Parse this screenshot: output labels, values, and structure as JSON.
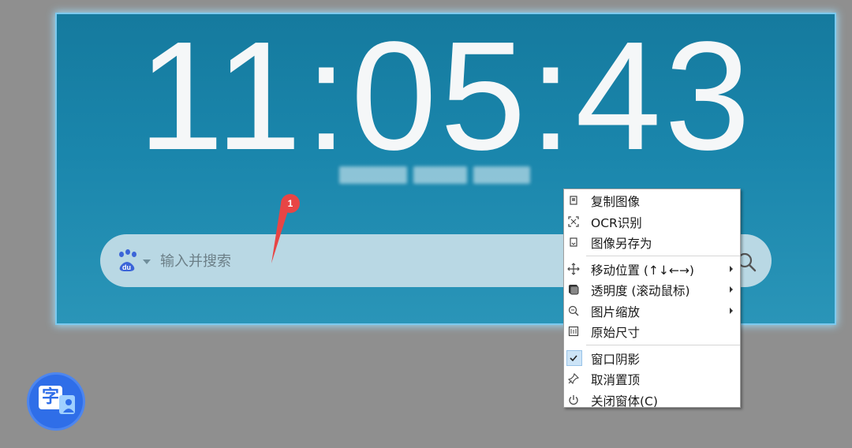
{
  "clock": {
    "time": "11:05:43"
  },
  "search": {
    "placeholder": "输入并搜索",
    "engine_icon": "baidu-paw-icon",
    "button_icon": "search-icon"
  },
  "annotation": {
    "marker_number": "1",
    "color": "#e84545"
  },
  "context_menu": {
    "items": [
      {
        "label": "复制图像",
        "icon": "copy-image-icon"
      },
      {
        "label": "OCR识别",
        "icon": "ocr-scan-icon"
      },
      {
        "label": "图像另存为",
        "icon": "save-image-icon"
      },
      {
        "label": "移动位置 (↑↓←→)",
        "icon": "move-icon",
        "submenu": true
      },
      {
        "label": "透明度 (滚动鼠标)",
        "icon": "opacity-icon",
        "submenu": true
      },
      {
        "label": "图片缩放",
        "icon": "zoom-icon",
        "submenu": true
      },
      {
        "label": "原始尺寸",
        "icon": "original-size-icon"
      },
      {
        "label": "窗口阴影",
        "icon": "check-icon",
        "checked": true
      },
      {
        "label": "取消置顶",
        "icon": "unpin-icon"
      },
      {
        "label": "关闭窗体(C)",
        "icon": "power-icon"
      }
    ]
  },
  "app_icon": {
    "glyph": "字",
    "icon": "translate-app-icon"
  },
  "colors": {
    "panel": "#1a86ac",
    "panel_glow": "#9fdcf7",
    "searchbar": "#b9d8e4",
    "menu_check": "#cce4f7",
    "app_blue": "#2f6ee8"
  }
}
